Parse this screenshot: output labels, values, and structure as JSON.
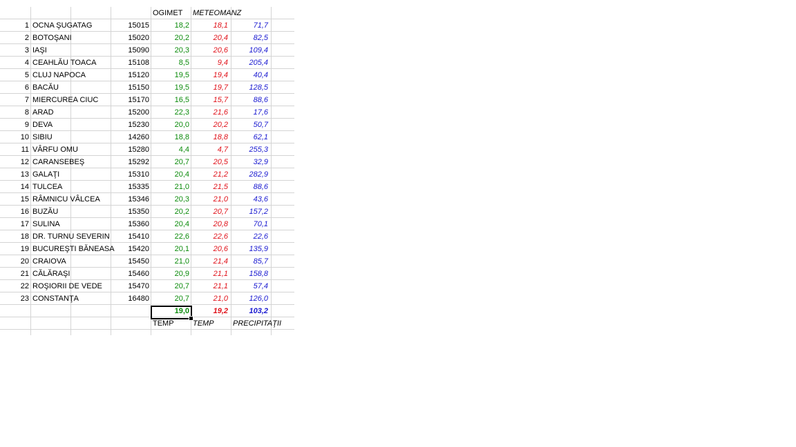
{
  "headers": {
    "ogimet": "OGIMET",
    "meteomanz": "METEOMANZ"
  },
  "stations": [
    {
      "idx": "1",
      "name": "OCNA ŞUGATAG",
      "code": "15015",
      "ogimet": "18,2",
      "meteomanz": "18,1",
      "precip": "71,7"
    },
    {
      "idx": "2",
      "name": "BOTOŞANI",
      "code": "15020",
      "ogimet": "20,2",
      "meteomanz": "20,4",
      "precip": "82,5"
    },
    {
      "idx": "3",
      "name": "IAŞI",
      "code": "15090",
      "ogimet": "20,3",
      "meteomanz": "20,6",
      "precip": "109,4"
    },
    {
      "idx": "4",
      "name": "CEAHLĂU TOACA",
      "code": "15108",
      "ogimet": "8,5",
      "meteomanz": "9,4",
      "precip": "205,4"
    },
    {
      "idx": "5",
      "name": "CLUJ NAPOCA",
      "code": "15120",
      "ogimet": "19,5",
      "meteomanz": "19,4",
      "precip": "40,4"
    },
    {
      "idx": "6",
      "name": "BACĂU",
      "code": "15150",
      "ogimet": "19,5",
      "meteomanz": "19,7",
      "precip": "128,5"
    },
    {
      "idx": "7",
      "name": "MIERCUREA CIUC",
      "code": "15170",
      "ogimet": "16,5",
      "meteomanz": "15,7",
      "precip": "88,6"
    },
    {
      "idx": "8",
      "name": "ARAD",
      "code": "15200",
      "ogimet": "22,3",
      "meteomanz": "21,6",
      "precip": "17,6"
    },
    {
      "idx": "9",
      "name": "DEVA",
      "code": "15230",
      "ogimet": "20,0",
      "meteomanz": "20,2",
      "precip": "50,7"
    },
    {
      "idx": "10",
      "name": "SIBIU",
      "code": "14260",
      "ogimet": "18,8",
      "meteomanz": "18,8",
      "precip": "62,1"
    },
    {
      "idx": "11",
      "name": "VÂRFU OMU",
      "code": "15280",
      "ogimet": "4,4",
      "meteomanz": "4,7",
      "precip": "255,3"
    },
    {
      "idx": "12",
      "name": "CARANSEBEŞ",
      "code": "15292",
      "ogimet": "20,7",
      "meteomanz": "20,5",
      "precip": "32,9"
    },
    {
      "idx": "13",
      "name": "GALAŢI",
      "code": "15310",
      "ogimet": "20,4",
      "meteomanz": "21,2",
      "precip": "282,9"
    },
    {
      "idx": "14",
      "name": "TULCEA",
      "code": "15335",
      "ogimet": "21,0",
      "meteomanz": "21,5",
      "precip": "88,6"
    },
    {
      "idx": "15",
      "name": "RÂMNICU VÂLCEA",
      "code": "15346",
      "ogimet": "20,3",
      "meteomanz": "21,0",
      "precip": "43,6"
    },
    {
      "idx": "16",
      "name": "BUZĂU",
      "code": "15350",
      "ogimet": "20,2",
      "meteomanz": "20,7",
      "precip": "157,2"
    },
    {
      "idx": "17",
      "name": "SULINA",
      "code": "15360",
      "ogimet": "20,4",
      "meteomanz": "20,8",
      "precip": "70,1"
    },
    {
      "idx": "18",
      "name": "DR. TURNU SEVERIN",
      "code": "15410",
      "ogimet": "22,6",
      "meteomanz": "22,6",
      "precip": "22,6"
    },
    {
      "idx": "19",
      "name": "BUCUREŞTI BĂNEASA",
      "code": "15420",
      "ogimet": "20,1",
      "meteomanz": "20,6",
      "precip": "135,9"
    },
    {
      "idx": "20",
      "name": "CRAIOVA",
      "code": "15450",
      "ogimet": "21,0",
      "meteomanz": "21,4",
      "precip": "85,7"
    },
    {
      "idx": "21",
      "name": "CĂLĂRAŞI",
      "code": "15460",
      "ogimet": "20,9",
      "meteomanz": "21,1",
      "precip": "158,8"
    },
    {
      "idx": "22",
      "name": "ROŞIORII DE VEDE",
      "code": "15470",
      "ogimet": "20,7",
      "meteomanz": "21,1",
      "precip": "57,4"
    },
    {
      "idx": "23",
      "name": "CONSTANŢA",
      "code": "16480",
      "ogimet": "20,7",
      "meteomanz": "21,0",
      "precip": "126,0"
    }
  ],
  "averages": {
    "ogimet": "19,0",
    "meteomanz": "19,2",
    "precip": "103,2"
  },
  "footer": {
    "temp1": "TEMP",
    "temp2": "TEMP",
    "precip": "PRECIPITAŢII"
  },
  "colors": {
    "ogimet": "#0a8a0a",
    "meteomanz": "#e0121a",
    "precip": "#1a1ad0",
    "grid": "#d4d4d4"
  }
}
